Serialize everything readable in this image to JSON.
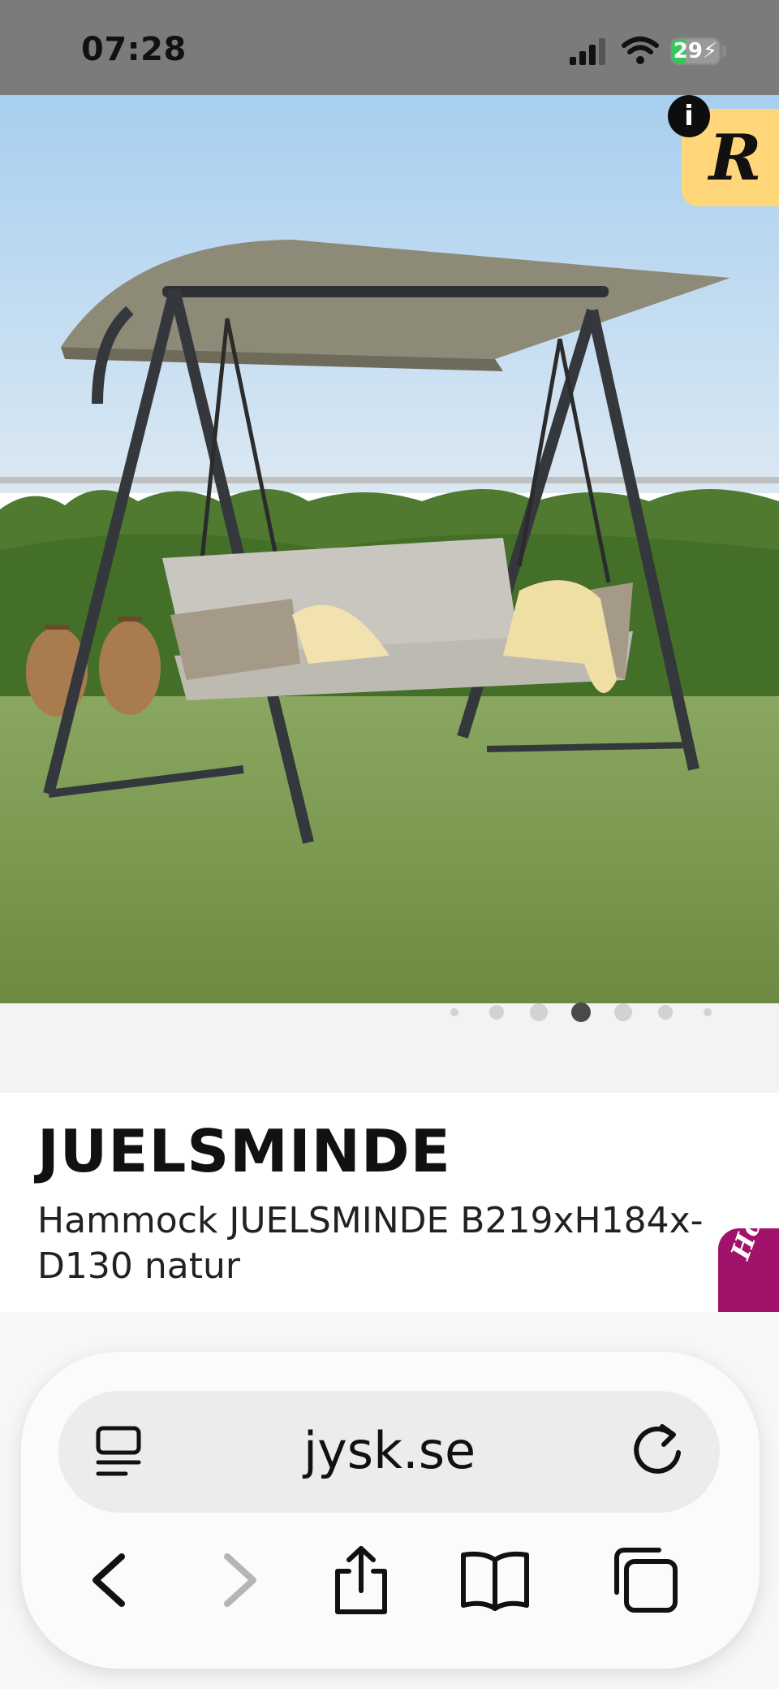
{
  "status_bar": {
    "time": "07:28",
    "battery": "29"
  },
  "hero": {
    "carousel": {
      "count": 7,
      "active_index": 3
    }
  },
  "badge": {
    "letter": "R",
    "info": "i"
  },
  "product": {
    "brand": "JUELSMINDE",
    "description": "Hammock JUELSMINDE B219xH184x-D130 natur"
  },
  "side_tab": {
    "label": "Holly"
  },
  "browser": {
    "url": "jysk.se",
    "icons": [
      "reader-icon",
      "reload-icon",
      "back-icon",
      "forward-icon",
      "share-icon",
      "bookmarks-icon",
      "tabs-icon"
    ]
  },
  "colors": {
    "status_bg": "#7b7b7b",
    "badge_bg": "#ffd67a",
    "side_tab_bg": "#a1126b",
    "battery_green": "#34c759"
  }
}
